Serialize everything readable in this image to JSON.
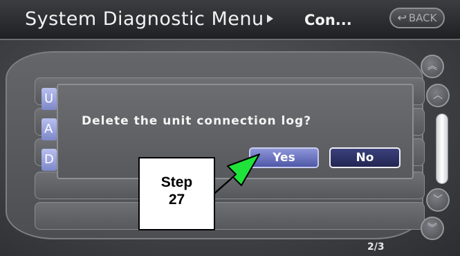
{
  "header": {
    "title": "System Diagnostic Menu",
    "subtitle": "Con...",
    "back_label": "BACK"
  },
  "list": {
    "item_letters": [
      "U",
      "A",
      "D"
    ]
  },
  "dialog": {
    "message": "Delete the unit connection log?",
    "yes_label": "Yes",
    "no_label": "No"
  },
  "pagination": {
    "indicator": "2/3"
  },
  "callout": {
    "step_line1": "Step",
    "step_line2": "27"
  },
  "icons": {
    "back": "return-arrow-icon",
    "scroll_top": "double-chevron-up-icon",
    "scroll_up": "chevron-up-icon",
    "scroll_down": "chevron-down-icon",
    "scroll_bottom": "double-chevron-down-icon",
    "callout_arrow": "green-arrow-icon"
  },
  "colors": {
    "accent": "#7d87c8",
    "arrow": "#1fe23a"
  }
}
